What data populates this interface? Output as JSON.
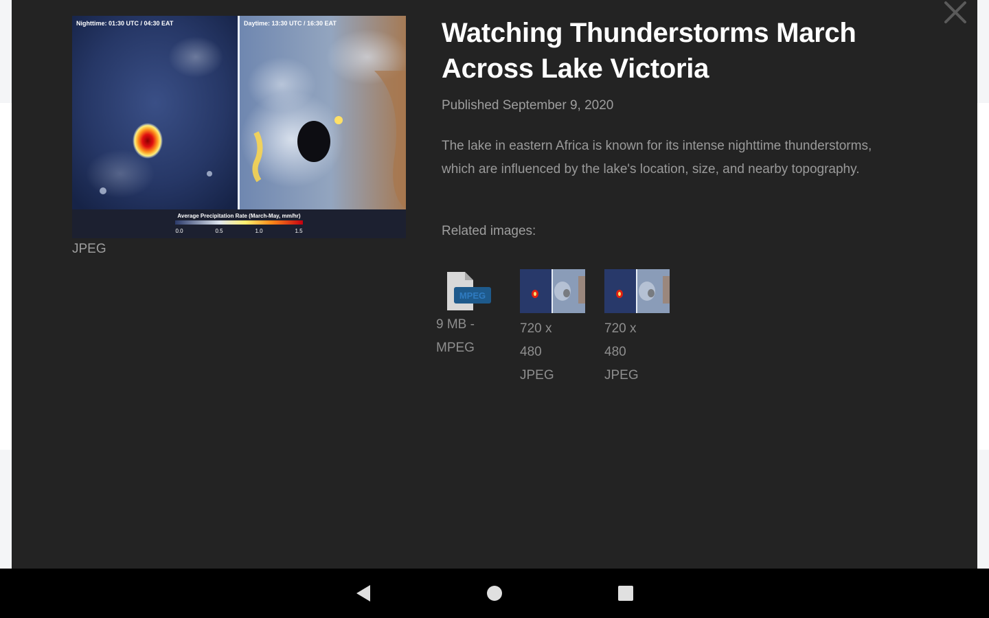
{
  "article": {
    "title": "Watching Thunderstorms March Across Lake Victoria",
    "published": "Published September 9, 2020",
    "description": "The lake in eastern Africa is known for its intense nighttime thunderstorms, which are influenced by the lake's location, size, and nearby topography.",
    "related_label": "Related images:"
  },
  "preview": {
    "format": "JPEG",
    "left_label": "Nighttime: 01:30 UTC / 04:30 EAT",
    "right_label": "Daytime: 13:30 UTC / 16:30 EAT",
    "colorbar_title": "Average Precipitation Rate (March-May, mm/hr)",
    "colorbar_ticks": [
      "0.0",
      "0.5",
      "1.0",
      "1.5"
    ]
  },
  "related": [
    {
      "icon": "mpeg-file-icon",
      "file_badge": "MPEG",
      "caption_lines": [
        "9 MB -",
        "MPEG"
      ]
    },
    {
      "icon": "image-thumbnail",
      "caption_lines": [
        "720 x",
        "480",
        "JPEG"
      ]
    },
    {
      "icon": "image-thumbnail",
      "caption_lines": [
        "720 x",
        "480",
        "JPEG"
      ]
    }
  ],
  "colors": {
    "modal_bg": "#232323",
    "text_primary": "#ffffff",
    "text_secondary": "#9e9e9e",
    "navbar_bg": "#000000"
  },
  "navbar": {
    "back_icon": "back-triangle-icon",
    "home_icon": "home-circle-icon",
    "recents_icon": "recents-square-icon"
  }
}
